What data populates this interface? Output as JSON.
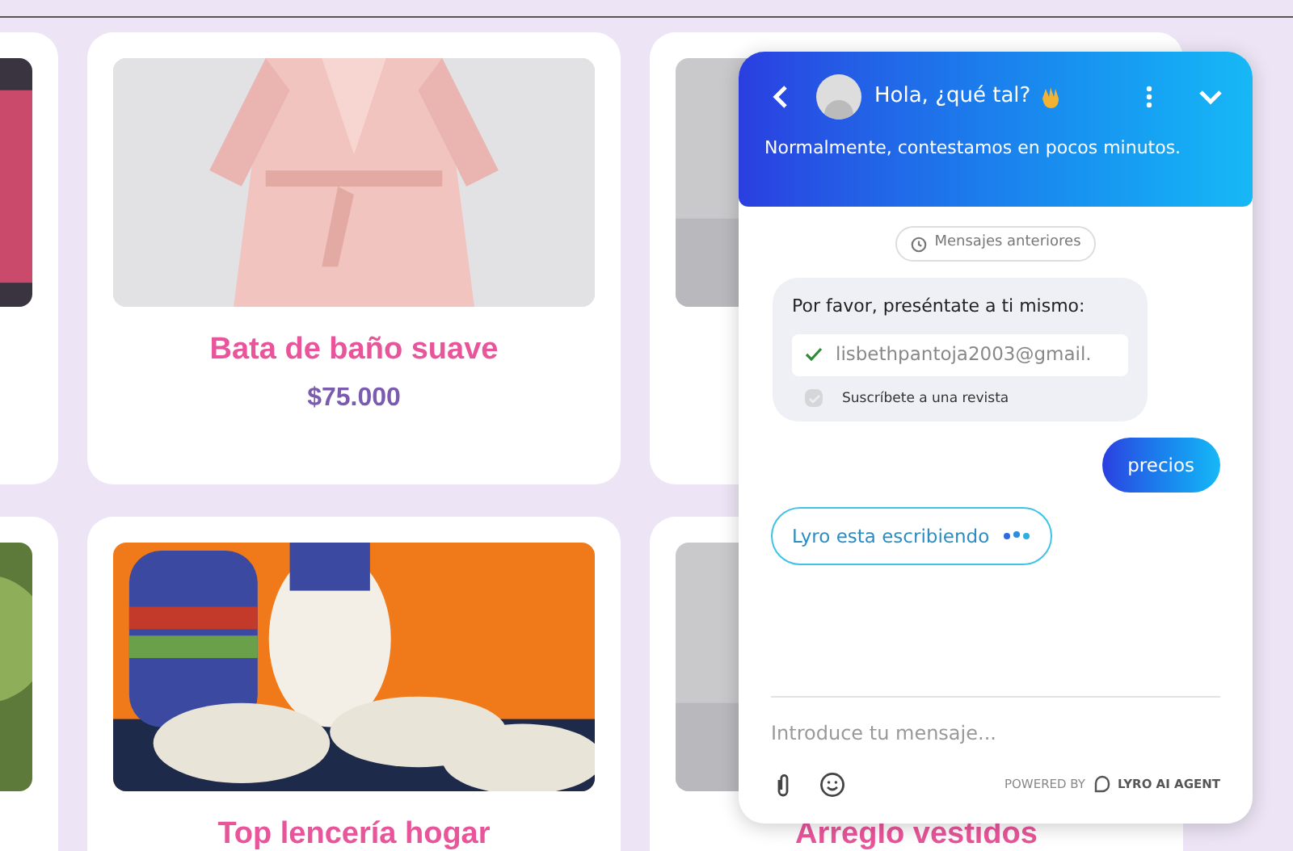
{
  "product_rows": [
    {
      "cards": [
        {
          "kind": "picture"
        },
        {
          "kind": "picture",
          "title": "Bata de baño suave",
          "price": "$75.000"
        },
        {
          "kind": "picture"
        }
      ]
    },
    {
      "cards": [
        {
          "kind": "picture"
        },
        {
          "kind": "picture",
          "title": "Top lencería hogar"
        },
        {
          "kind": "picture",
          "title": "Arreglo vestidos"
        }
      ]
    }
  ],
  "chat": {
    "title": "Hola, ¿qué tal?",
    "subtitle": "Normalmente, contestamos en pocos minutos.",
    "history_button": "Mensajes anteriores",
    "form": {
      "prompt": "Por favor, preséntate a ti mismo:",
      "email": "lisbethpantoja2003@gmail.",
      "email_valid": true,
      "subscribe": {
        "label": "Suscríbete a una revista",
        "checked": true,
        "disabled": true
      }
    },
    "user_message": "precios",
    "typing": "Lyro esta escribiendo",
    "input": {
      "placeholder": "Introduce tu mensaje..."
    },
    "powered_by": "POWERED BY",
    "brand": "LYRO AI AGENT"
  }
}
